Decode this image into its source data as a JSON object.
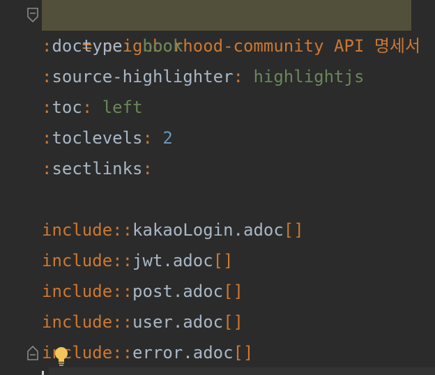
{
  "editor": {
    "title_line": "= neighborhood-community API 명세서",
    "attributes": [
      {
        "name": "doctype",
        "value": "book",
        "kind": "value"
      },
      {
        "name": "source-highlighter",
        "value": "highlightjs",
        "kind": "value"
      },
      {
        "name": "toc",
        "value": "left",
        "kind": "value"
      },
      {
        "name": "toclevels",
        "value": "2",
        "kind": "number"
      },
      {
        "name": "sectlinks",
        "value": "",
        "kind": "value"
      }
    ],
    "includes": [
      {
        "keyword": "include::",
        "path": "kakaoLogin.adoc",
        "brackets": "[]"
      },
      {
        "keyword": "include::",
        "path": "jwt.adoc",
        "brackets": "[]"
      },
      {
        "keyword": "include::",
        "path": "post.adoc",
        "brackets": "[]"
      },
      {
        "keyword": "include::",
        "path": "user.adoc",
        "brackets": "[]"
      },
      {
        "keyword": "include::",
        "path": "error.adoc",
        "brackets": "[]"
      }
    ],
    "colors": {
      "background": "#2b2b2b",
      "title_highlight": "#52503a",
      "keyword_orange": "#cc7832",
      "string_green": "#6a8759",
      "number_blue": "#6897bb",
      "default_text": "#a9b7c6"
    },
    "icons": [
      "fold-open-icon",
      "fold-close-icon",
      "intention-bulb-icon"
    ]
  }
}
